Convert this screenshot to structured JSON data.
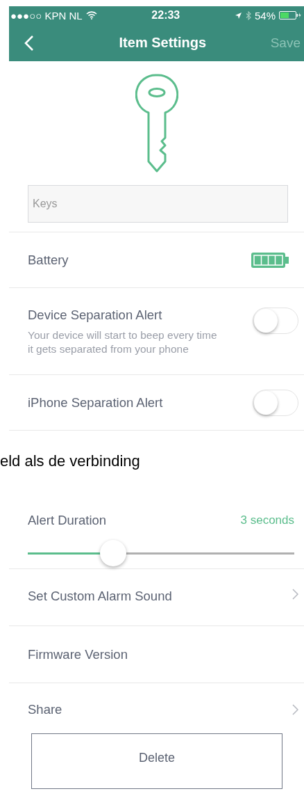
{
  "status_bar": {
    "carrier": "●●●○○ KPN NL",
    "time": "22:33",
    "battery_percent": "54%"
  },
  "nav_bar": {
    "title": "Item Settings",
    "save": {
      "label": "Save",
      "disabled": true
    }
  },
  "name_field": {
    "value": "Keys"
  },
  "rows": [
    {
      "kind": "battery",
      "label": "Battery"
    },
    {
      "kind": "toggle",
      "label": "Device Separation Alert",
      "description": "Your device will start to beep every time it gets separated from your phone",
      "on": false
    },
    {
      "kind": "toggle",
      "label": "iPhone Separation Alert",
      "on": false
    }
  ],
  "overlay_text": "eld als de verbinding",
  "settings": [
    {
      "kind": "slider",
      "label": "Alert Duration",
      "reading": "3 seconds",
      "level": 0.32
    },
    {
      "kind": "link",
      "label": "Set Custom Alarm Sound"
    },
    {
      "kind": "info",
      "label": "Firmware Version"
    },
    {
      "kind": "link",
      "label": "Share"
    }
  ],
  "delete_button": "Delete"
}
